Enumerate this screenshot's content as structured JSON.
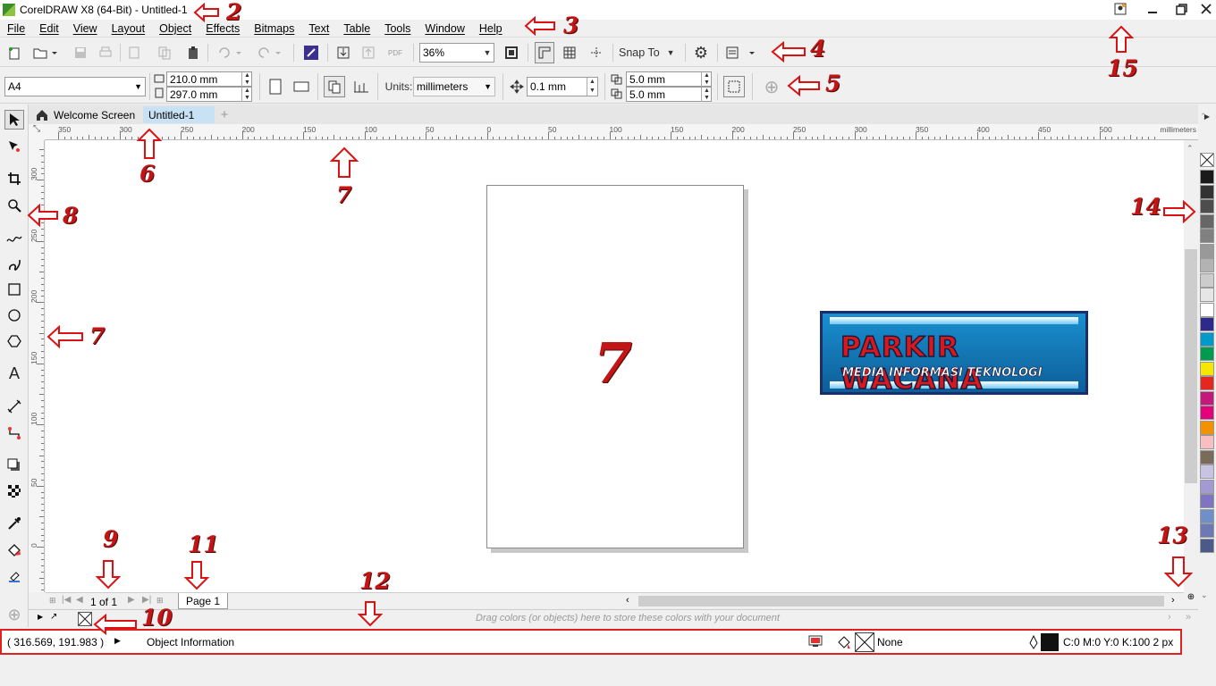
{
  "window": {
    "title": "CorelDRAW X8 (64-Bit) - Untitled-1"
  },
  "menu": [
    "File",
    "Edit",
    "View",
    "Layout",
    "Object",
    "Effects",
    "Bitmaps",
    "Text",
    "Table",
    "Tools",
    "Window",
    "Help"
  ],
  "standard_toolbar": {
    "zoom": "36%",
    "snap_to": "Snap To"
  },
  "property_bar": {
    "paper_size": "A4",
    "width": "210.0 mm",
    "height": "297.0 mm",
    "units_label": "Units:",
    "units": "millimeters",
    "nudge": "0.1 mm",
    "duplicate_x": "5.0 mm",
    "duplicate_y": "5.0 mm"
  },
  "tabs": {
    "welcome": "Welcome Screen",
    "document": "Untitled-1",
    "add": "+"
  },
  "ruler": {
    "units": "millimeters",
    "h_ticks": [
      "350",
      "300",
      "250",
      "200",
      "150",
      "100",
      "50",
      "0",
      "50",
      "100",
      "150",
      "200",
      "250",
      "300",
      "350",
      "400",
      "450",
      "500"
    ],
    "v_ticks": [
      "300",
      "250",
      "200",
      "150",
      "100",
      "50",
      "0"
    ]
  },
  "page_nav": {
    "page_of": "1  of  1",
    "page_tab": "Page 1"
  },
  "document_palette": {
    "hint": "Drag colors (or objects) here to store these colors with your document"
  },
  "status": {
    "coords": "( 316.569, 191.983 )",
    "object_info": "Object Information",
    "fill": "None",
    "outline": "C:0 M:0 Y:0 K:100  2 px"
  },
  "logo": {
    "line1": "PARKIR WACANA",
    "line2": "MEDIA INFORMASI TEKNOLOGI"
  },
  "annotations": {
    "a2": "2",
    "a3": "3",
    "a4": "4",
    "a5": "5",
    "a6": "6",
    "a7": "7",
    "a7b": "7",
    "a7c": "7",
    "a8": "8",
    "a9": "9",
    "a10": "10",
    "a11": "11",
    "a12": "12",
    "a13": "13",
    "a14": "14",
    "a15": "15"
  },
  "palette_colors": [
    "#1a1a1a",
    "#333333",
    "#4d4d4d",
    "#666666",
    "#808080",
    "#999999",
    "#b3b3b3",
    "#cccccc",
    "#e6e6e6",
    "#ffffff",
    "#2e2a8c",
    "#0099cc",
    "#009b4e",
    "#f7e600",
    "#e5281d",
    "#c4187d",
    "#e4007c",
    "#f39200",
    "#f9bfc0",
    "#7a6a5a",
    "#c8c3e3",
    "#a39ad3",
    "#7f74c1",
    "#6f8fc9",
    "#6c79b5",
    "#4c5a8a"
  ]
}
